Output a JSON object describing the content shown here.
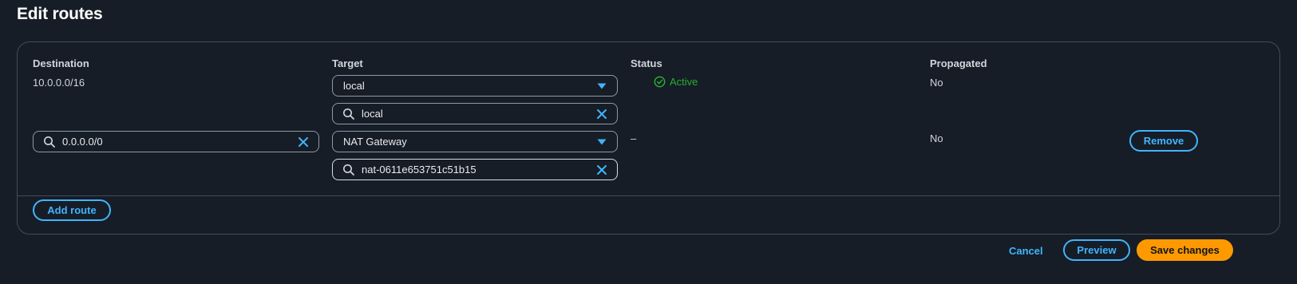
{
  "page": {
    "title": "Edit routes"
  },
  "columns": {
    "destination": "Destination",
    "target": "Target",
    "status": "Status",
    "propagated": "Propagated"
  },
  "routes": [
    {
      "destination": "10.0.0.0/16",
      "target_type": "local",
      "target_search": "local",
      "status": "Active",
      "propagated": "No"
    },
    {
      "destination": "0.0.0.0/0",
      "target_type": "NAT Gateway",
      "target_search": "nat-0611e653751c51b15",
      "status": "–",
      "propagated": "No",
      "remove_label": "Remove"
    }
  ],
  "actions": {
    "add_route": "Add route",
    "cancel": "Cancel",
    "preview": "Preview",
    "save": "Save changes"
  },
  "colors": {
    "background": "#161d26",
    "accent": "#42b4ff",
    "primary": "#ff9900",
    "success": "#29ad32",
    "border": "#414d5c"
  },
  "icons": {
    "search": "search-icon",
    "clear": "close-icon",
    "caret": "caret-down-icon",
    "status": "check-circle-icon"
  }
}
